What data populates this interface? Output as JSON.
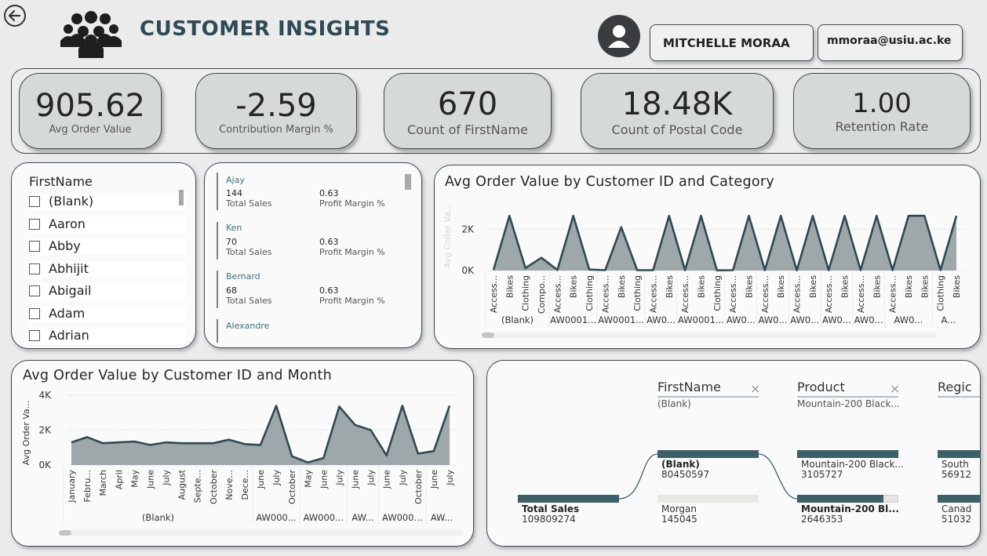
{
  "header": {
    "title": "CUSTOMER INSIGHTS",
    "user_name": "MITCHELLE MORAA",
    "user_email": "mmoraa@usiu.ac.ke"
  },
  "kpis": [
    {
      "value": "905.62",
      "label": "Avg Order Value"
    },
    {
      "value": "-2.59",
      "label": "Contribution Margin %"
    },
    {
      "value": "670",
      "label": "Count of FirstName"
    },
    {
      "value": "18.48K",
      "label": "Count of Postal Code"
    },
    {
      "value": "1.00",
      "label": "Retention Rate"
    }
  ],
  "slicer": {
    "title": "FirstName",
    "items": [
      "(Blank)",
      "Aaron",
      "Abby",
      "Abhijit",
      "Abigail",
      "Adam",
      "Adrian"
    ]
  },
  "card_list": {
    "entries": [
      {
        "name": "Ajay",
        "sales": "144",
        "sales_label": "Total Sales",
        "margin": "0.63",
        "margin_label": "Profit Margin %"
      },
      {
        "name": "Ken",
        "sales": "70",
        "sales_label": "Total Sales",
        "margin": "0.63",
        "margin_label": "Profit Margin %"
      },
      {
        "name": "Bernard",
        "sales": "68",
        "sales_label": "Total Sales",
        "margin": "0.63",
        "margin_label": "Profit Margin %"
      },
      {
        "name": "Alexandre"
      }
    ]
  },
  "chart_data": [
    {
      "type": "area",
      "title": "Avg Order Value by Customer ID and Category",
      "ylabel": "Avg Order Va...",
      "xlabel": "",
      "y_ticks": [
        "2K",
        "0K"
      ],
      "ylim": [
        0,
        3000
      ],
      "categories": [
        "Access...",
        "Bikes",
        "Clothing",
        "Compo...",
        "Access...",
        "Bikes",
        "Clothing",
        "Access...",
        "Bikes",
        "Clothing",
        "Access...",
        "Bikes",
        "Access...",
        "Bikes",
        "Clothing",
        "Access...",
        "Bikes",
        "Access...",
        "Bikes",
        "Access...",
        "Bikes",
        "Access...",
        "Bikes",
        "Access...",
        "Bikes",
        "Access...",
        "Bikes",
        "Bikes",
        "Clothing",
        "Bikes"
      ],
      "groups": [
        {
          "label": "(Blank)",
          "span": 4
        },
        {
          "label": "AW0001...",
          "span": 3
        },
        {
          "label": "AW0001...",
          "span": 3
        },
        {
          "label": "AW0...",
          "span": 2
        },
        {
          "label": "AW0001...",
          "span": 3
        },
        {
          "label": "AW0...",
          "span": 2
        },
        {
          "label": "AW0...",
          "span": 2
        },
        {
          "label": "AW0...",
          "span": 2
        },
        {
          "label": "AW0...",
          "span": 2
        },
        {
          "label": "AW0...",
          "span": 2
        },
        {
          "label": "AW0...",
          "span": 3
        },
        {
          "label": "A...",
          "span": 2
        }
      ],
      "values": [
        30,
        2650,
        120,
        620,
        30,
        2650,
        50,
        20,
        2100,
        20,
        20,
        2650,
        20,
        2650,
        10,
        20,
        2650,
        20,
        2650,
        10,
        2650,
        20,
        2650,
        20,
        2650,
        20,
        2650,
        2650,
        20,
        2650
      ],
      "grid": true
    },
    {
      "type": "area",
      "title": "Avg Order Value by Customer ID and Month",
      "ylabel": "Avg Order Va...",
      "xlabel": "",
      "y_ticks": [
        "4K",
        "2K",
        "0K"
      ],
      "ylim": [
        0,
        4000
      ],
      "categories": [
        "January",
        "Febru...",
        "March",
        "April",
        "May",
        "June",
        "July",
        "August",
        "Septe...",
        "October",
        "Nove...",
        "Dece...",
        "June",
        "July",
        "October",
        "May",
        "June",
        "July",
        "June",
        "July",
        "June",
        "July",
        "October",
        "June",
        "July"
      ],
      "groups": [
        {
          "label": "(Blank)",
          "span": 12
        },
        {
          "label": "AW000...",
          "span": 3
        },
        {
          "label": "AW000...",
          "span": 3
        },
        {
          "label": "AW...",
          "span": 2
        },
        {
          "label": "AW000...",
          "span": 3
        },
        {
          "label": "AW...",
          "span": 2
        }
      ],
      "values": [
        1300,
        1600,
        1250,
        1300,
        1350,
        1150,
        1300,
        1250,
        1250,
        1250,
        1450,
        1200,
        1150,
        3400,
        500,
        150,
        400,
        3350,
        2300,
        2000,
        550,
        3400,
        650,
        800,
        3400
      ],
      "grid": true
    }
  ],
  "decomp_tree": {
    "levels": [
      {
        "label": "FirstName",
        "filter": "(Blank)"
      },
      {
        "label": "Product",
        "filter": "Mountain-200 Black..."
      },
      {
        "label": "Regic",
        "filter": ""
      }
    ],
    "root": {
      "label": "Total Sales",
      "value": "109809274"
    },
    "firstname_nodes": [
      {
        "label": "(Blank)",
        "value": "80450597",
        "share": 0.73
      },
      {
        "label": "Morgan",
        "value": "145045",
        "share": 0.0013
      }
    ],
    "product_nodes": [
      {
        "label": "Mountain-200 Black...",
        "value": "3105727",
        "share": 1.0
      },
      {
        "label": "Mountain-200 Bl...",
        "value": "2646353",
        "share": 0.85
      }
    ],
    "region_nodes": [
      {
        "label": "South",
        "value": "56912"
      },
      {
        "label": "Canad",
        "value": "51032"
      }
    ]
  }
}
